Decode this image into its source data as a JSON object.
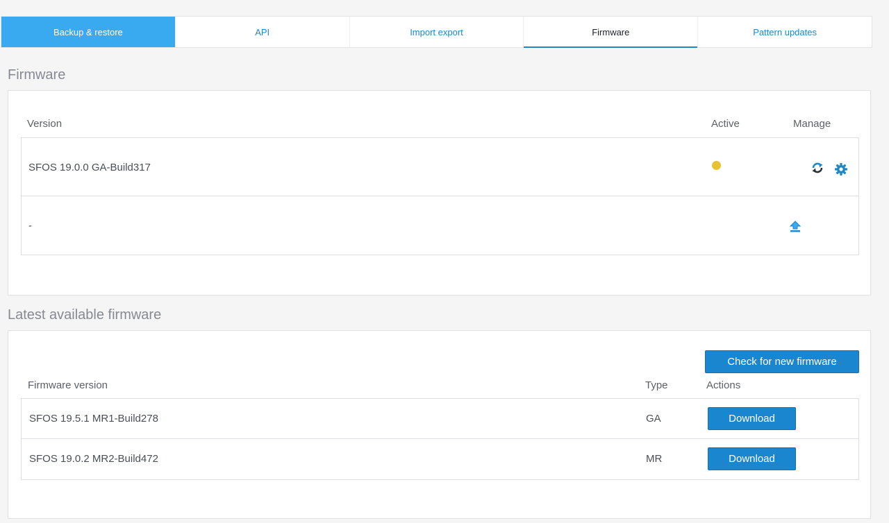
{
  "tabs": [
    {
      "label": "Backup & restore",
      "state": "primary"
    },
    {
      "label": "API",
      "state": "normal"
    },
    {
      "label": "Import export",
      "state": "normal"
    },
    {
      "label": "Firmware",
      "state": "current"
    },
    {
      "label": "Pattern updates",
      "state": "normal"
    }
  ],
  "firmware": {
    "title": "Firmware",
    "columns": {
      "version": "Version",
      "active": "Active",
      "manage": "Manage"
    },
    "rows": [
      {
        "version": "SFOS 19.0.0 GA-Build317",
        "active": true,
        "manage_icons": [
          "reboot-icon",
          "settings-gear-icon"
        ]
      },
      {
        "version": "-",
        "active": false,
        "manage_icons": [
          "upload-firmware-icon"
        ]
      }
    ]
  },
  "latest": {
    "title": "Latest available firmware",
    "check_button": "Check for new firmware",
    "columns": {
      "version": "Firmware version",
      "type": "Type",
      "actions": "Actions"
    },
    "rows": [
      {
        "version": "SFOS 19.5.1 MR1-Build278",
        "type": "GA",
        "action": "Download"
      },
      {
        "version": "SFOS 19.0.2 MR2-Build472",
        "type": "MR",
        "action": "Download"
      }
    ]
  },
  "colors": {
    "accent": "#1b86d0",
    "tab_primary": "#39a9f0",
    "active_dot": "#e9c233"
  }
}
